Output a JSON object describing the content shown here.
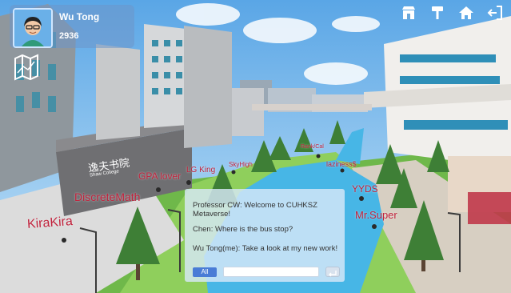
{
  "player": {
    "name": "Wu Tong",
    "coins": "2936"
  },
  "top_icons": [
    "shop-icon",
    "brush-icon",
    "home-icon",
    "exit-icon"
  ],
  "map_button": {
    "icon": "map-icon"
  },
  "signs": {
    "college_chinese": "逸夫书院",
    "college_english": "Shaw College"
  },
  "labels": {
    "kirakira": "KiraKira",
    "discretemath": "DiscreteMath",
    "gpalover": "GPA lover",
    "lgking": "LG King",
    "skyhigh": "SkyHigh",
    "rankwinners": "Rank/Cal",
    "laziness": "laziness$",
    "yyds": "YYDS",
    "mrsuper": "Mr.Super"
  },
  "chat": {
    "messages": [
      "Professor CW: Welcome to CUHKSZ Metaverse!",
      "Chen: Where is the bus stop?",
      "Wu Tong(me): Take a look at my new work!"
    ],
    "channel": "All",
    "input_value": ""
  },
  "colors": {
    "label_red": "#c0223c",
    "sky": "#8fc7ef",
    "grass": "#6fb84a",
    "water": "#47b6e6",
    "channel_blue": "#4a7cd6"
  }
}
